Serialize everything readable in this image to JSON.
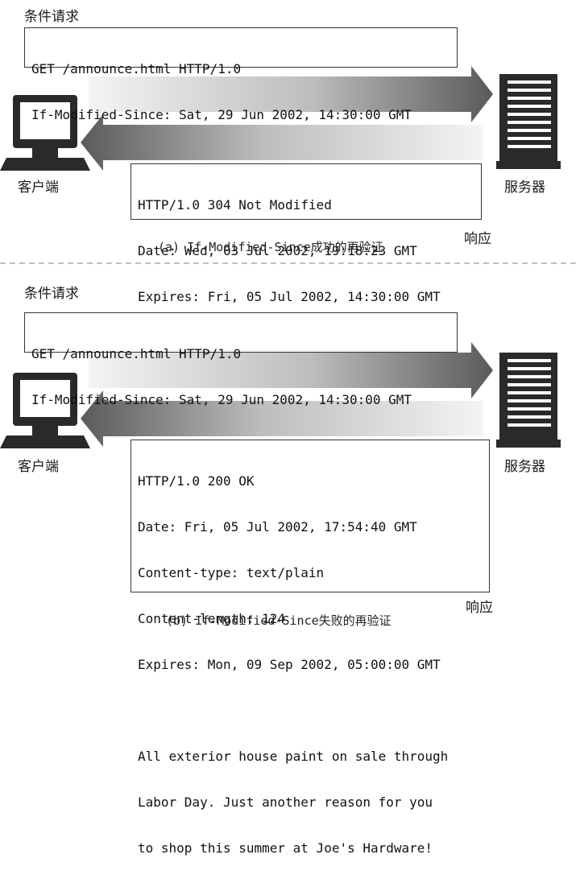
{
  "panel_a": {
    "request_title": "条件请求",
    "request_lines": [
      "GET /announce.html HTTP/1.0",
      "If-Modified-Since: Sat, 29 Jun 2002, 14:30:00 GMT"
    ],
    "response_lines": [
      "HTTP/1.0 304 Not Modified",
      "Date: Wed, 03 Jul 2002, 19:18:23 GMT",
      "Expires: Fri, 05 Jul 2002, 14:30:00 GMT"
    ],
    "response_label": "响应",
    "client_label": "客户端",
    "server_label": "服务器",
    "caption_prefix": "(a)",
    "caption_code": "If-Modified-Since",
    "caption_text": "成功的再验证"
  },
  "panel_b": {
    "request_title": "条件请求",
    "request_lines": [
      "GET /announce.html HTTP/1.0",
      "If-Modified-Since: Sat, 29 Jun 2002, 14:30:00 GMT"
    ],
    "response_lines": [
      "HTTP/1.0 200 OK",
      "Date: Fri, 05 Jul 2002, 17:54:40 GMT",
      "Content-type: text/plain",
      "Content-length: 124",
      "Expires: Mon, 09 Sep 2002, 05:00:00 GMT",
      "",
      "All exterior house paint on sale through",
      "Labor Day. Just another reason for you",
      "to shop this summer at Joe's Hardware!"
    ],
    "response_label": "响应",
    "client_label": "客户端",
    "server_label": "服务器",
    "caption_prefix": "(b)",
    "caption_code": "If-Modified-Since",
    "caption_text": "失败的再验证"
  },
  "colors": {
    "arrow_dark": "#5e5e5e",
    "arrow_light": "#f2f2f2",
    "icon": "#2a2a2a",
    "divider": "#9a9a9a"
  }
}
